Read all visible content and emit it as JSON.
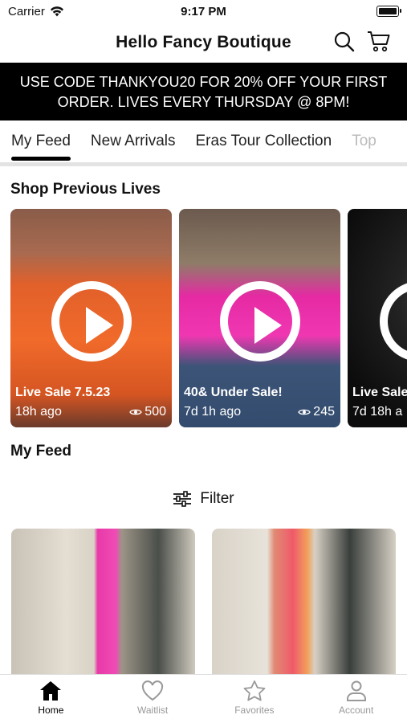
{
  "status": {
    "carrier": "Carrier",
    "time": "9:17 PM"
  },
  "header": {
    "title": "Hello Fancy Boutique"
  },
  "banner": {
    "text": "USE CODE THANKYOU20 FOR 20% OFF YOUR FIRST ORDER. LIVES EVERY THURSDAY @ 8PM!"
  },
  "tabs": [
    "My Feed",
    "New Arrivals",
    "Eras Tour Collection",
    "Top"
  ],
  "lives_section": {
    "title": "Shop Previous Lives",
    "items": [
      {
        "title": "Live Sale 7.5.23",
        "age": "18h ago",
        "views": "500"
      },
      {
        "title": "40& Under Sale!",
        "age": "7d 1h ago",
        "views": "245"
      },
      {
        "title": "Live Sale",
        "age": "7d 18h a",
        "views": ""
      }
    ]
  },
  "feed": {
    "title": "My Feed",
    "filter_label": "Filter"
  },
  "tabbar": [
    "Home",
    "Waitlist",
    "Favorites",
    "Account"
  ],
  "colors": {
    "accent": "#000000",
    "inactive": "#999999"
  }
}
